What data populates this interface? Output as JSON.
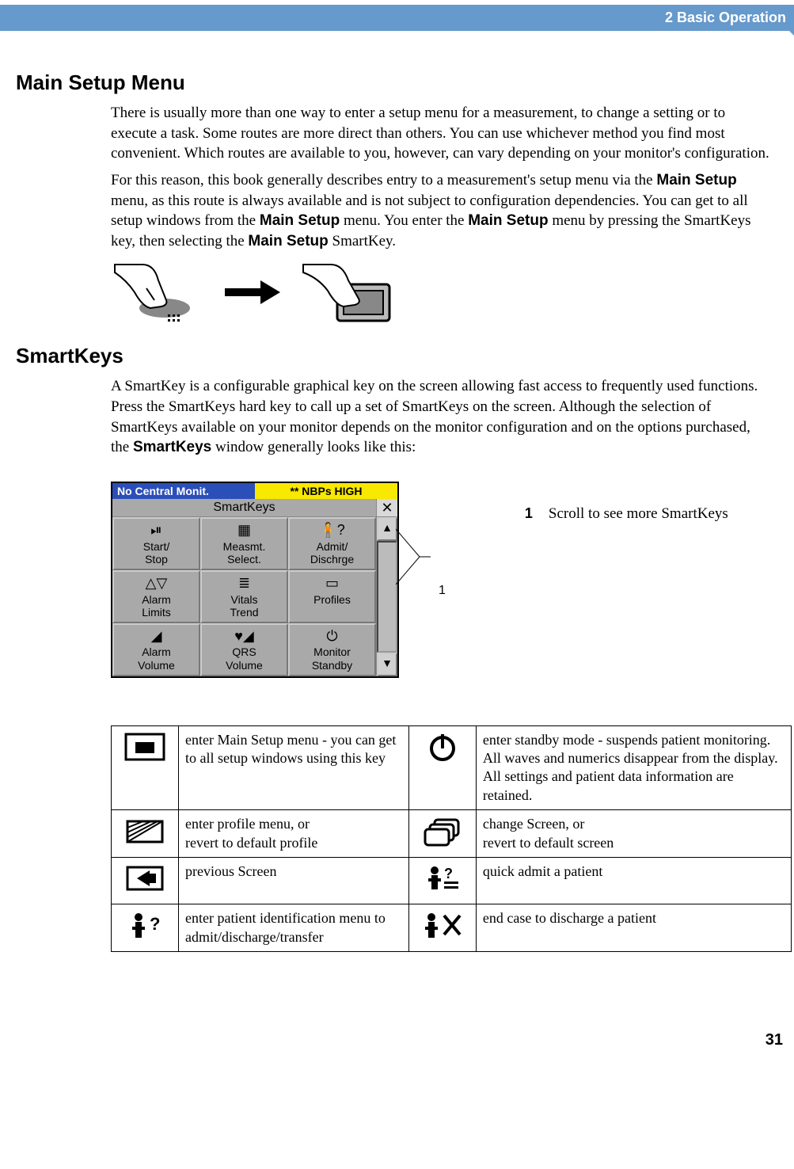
{
  "header": {
    "chapter": "2  Basic Operation"
  },
  "section1": {
    "title": "Main Setup Menu",
    "para1_pre": "There is usually more than one way to enter a setup menu for a measurement, to change a setting or to execute a task. Some routes are more direct than others. You can use whichever method you find most convenient. Which routes are available to you, however, can vary depending on your monitor's configuration.",
    "para2_a": "For this reason, this book generally describes entry to a measurement's setup menu via the ",
    "para2_b_bold": "Main Setup",
    "para2_c": " menu, as this route is always available and is not subject to configuration dependencies. You can get to all setup windows from the ",
    "para2_d_bold": "Main Setup",
    "para2_e": " menu. You enter the ",
    "para2_f_bold": "Main Setup",
    "para2_g": " menu by pressing the SmartKeys key, then selecting the ",
    "para2_h_bold": "Main Setup",
    "para2_i": " SmartKey."
  },
  "section2": {
    "title": "SmartKeys",
    "para1_a": "A SmartKey is a configurable graphical key on the screen allowing fast access to frequently used functions. Press the SmartKeys hard key to call up a set of SmartKeys on the screen. Although the selection of SmartKeys available on your monitor depends on the monitor configuration and on the options purchased, the ",
    "para1_b_bold": "SmartKeys",
    "para1_c": " window generally looks like this:"
  },
  "sk_window": {
    "status_left": "No Central Monit.",
    "status_right": "** NBPs HIGH",
    "title": "SmartKeys",
    "close": "✕",
    "scroll_up": "▲",
    "scroll_down": "▼",
    "cells": [
      {
        "label": "Start/\nStop",
        "icon": "⏯"
      },
      {
        "label": "Measmt.\nSelect.",
        "icon": "▦"
      },
      {
        "label": "Admit/\nDischrge",
        "icon": "🧍?"
      },
      {
        "label": "Alarm\nLimits",
        "icon": "△▽"
      },
      {
        "label": "Vitals\nTrend",
        "icon": "≣"
      },
      {
        "label": "Profiles",
        "icon": "▭"
      },
      {
        "label": "Alarm\nVolume",
        "icon": "◢"
      },
      {
        "label": "QRS\nVolume",
        "icon": "♥◢"
      },
      {
        "label": "Monitor\nStandby",
        "icon": "⏻"
      }
    ]
  },
  "legend": {
    "num": "1",
    "text": "Scroll to see more SmartKeys",
    "callout": "1"
  },
  "icon_table": {
    "rows": [
      {
        "left_desc": "enter Main Setup menu - you can get to all setup windows using this key",
        "right_desc": "enter standby mode - suspends patient monitoring. All waves and numerics disappear from the display. All settings and patient data information are retained.",
        "left_icon": "main-setup-icon",
        "right_icon": "standby-icon"
      },
      {
        "left_desc": "enter profile menu, or\nrevert to default profile",
        "right_desc": "change Screen, or\nrevert to default screen",
        "left_icon": "profile-icon",
        "right_icon": "change-screen-icon"
      },
      {
        "left_desc": "previous Screen",
        "right_desc": "quick admit a patient",
        "left_icon": "previous-screen-icon",
        "right_icon": "quick-admit-icon"
      },
      {
        "left_desc": "enter patient identification menu to admit/discharge/transfer",
        "right_desc": "end case to discharge a patient",
        "left_icon": "patient-id-icon",
        "right_icon": "end-case-icon"
      }
    ]
  },
  "page_number": "31"
}
